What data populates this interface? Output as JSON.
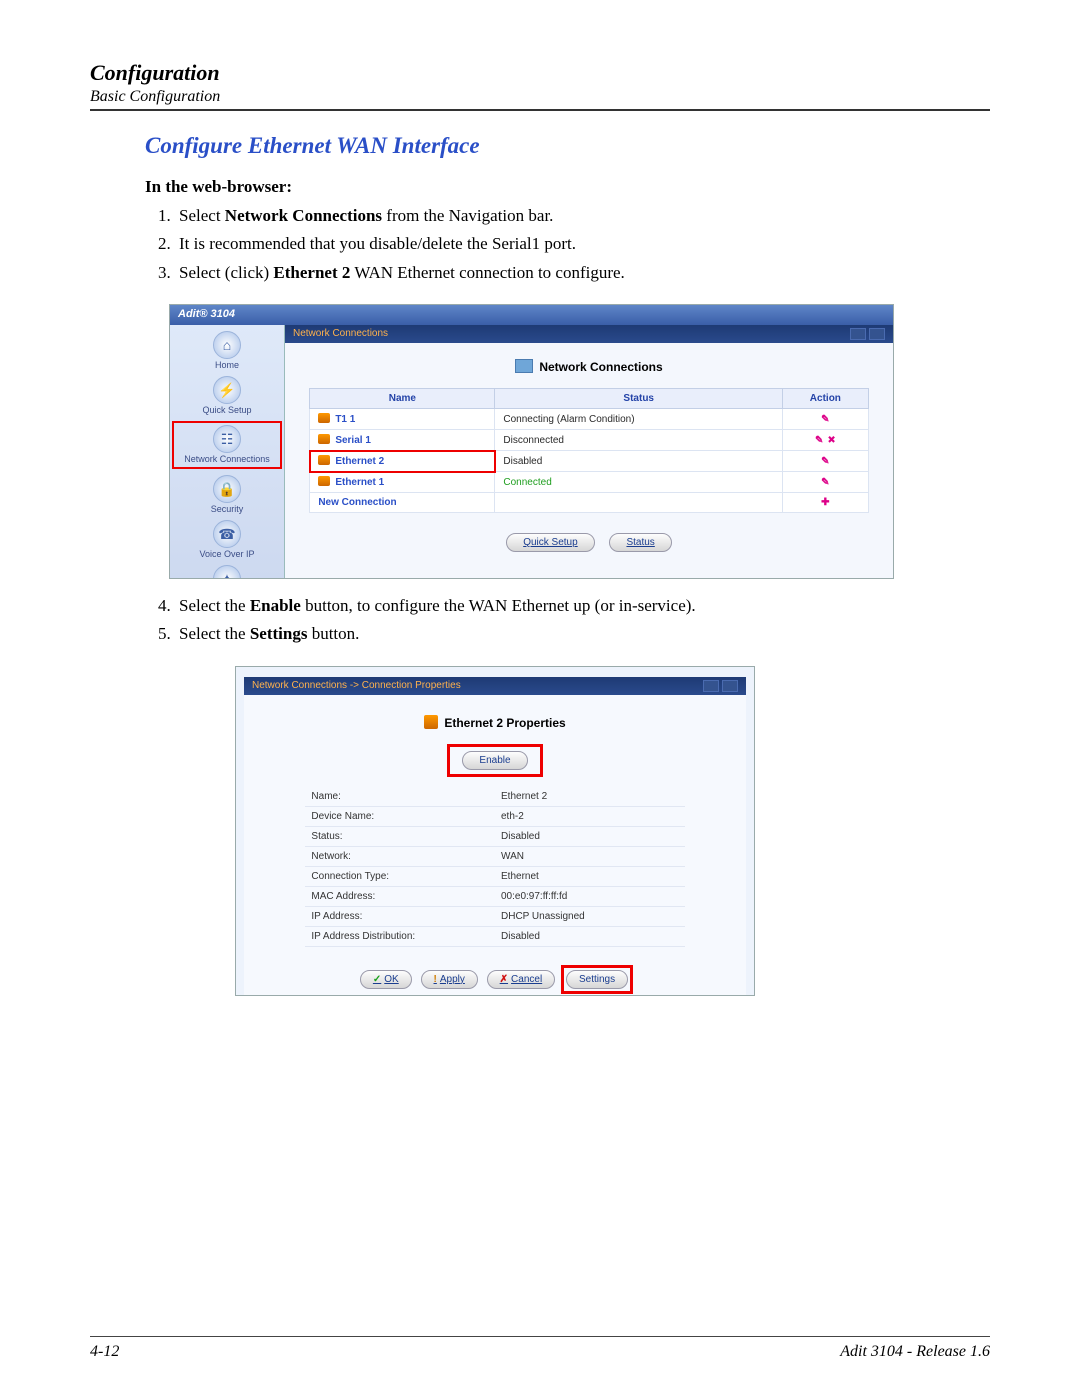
{
  "header": {
    "title": "Configuration",
    "sub": "Basic Configuration"
  },
  "section": {
    "title": "Configure Ethernet WAN Interface",
    "subhead": "In the web-browser:"
  },
  "steps": {
    "s1a": "Select ",
    "s1b": "Network Connections",
    "s1c": " from the Navigation bar.",
    "s2": "It is recommended that you disable/delete the Serial1 port.",
    "s3a": "Select (click) ",
    "s3b": "Ethernet 2",
    "s3c": " WAN Ethernet connection to configure.",
    "s4a": "Select the ",
    "s4b": "Enable",
    "s4c": " button, to configure the WAN Ethernet up (or in-service).",
    "s5a": "Select the ",
    "s5b": "Settings",
    "s5c": " button."
  },
  "shot1": {
    "app": "Adit® 3104",
    "crumb": "Network Connections",
    "paneTitle": "Network Connections",
    "nav": {
      "home": "Home",
      "quick": "Quick Setup",
      "net": "Network Connections",
      "sec": "Security",
      "voip": "Voice Over IP"
    },
    "cols": {
      "name": "Name",
      "status": "Status",
      "action": "Action"
    },
    "rows": [
      {
        "name": "T1 1",
        "status": "Connecting (Alarm Condition)",
        "cls": ""
      },
      {
        "name": "Serial 1",
        "status": "Disconnected",
        "cls": ""
      },
      {
        "name": "Ethernet 2",
        "status": "Disabled",
        "cls": "hl"
      },
      {
        "name": "Ethernet 1",
        "status": "Connected",
        "cls": "green"
      }
    ],
    "newconn": "New Connection",
    "btnQuick": "Quick Setup",
    "btnStatus": "Status"
  },
  "shot2": {
    "crumb": "Network Connections -> Connection Properties",
    "title": "Ethernet 2 Properties",
    "enable": "Enable",
    "rows": [
      {
        "k": "Name:",
        "v": "Ethernet 2"
      },
      {
        "k": "Device Name:",
        "v": "eth-2"
      },
      {
        "k": "Status:",
        "v": "Disabled"
      },
      {
        "k": "Network:",
        "v": "WAN"
      },
      {
        "k": "Connection Type:",
        "v": "Ethernet"
      },
      {
        "k": "MAC Address:",
        "v": "00:e0:97:ff:ff:fd"
      },
      {
        "k": "IP Address:",
        "v": "DHCP Unassigned"
      },
      {
        "k": "IP Address Distribution:",
        "v": "Disabled"
      }
    ],
    "ok": "OK",
    "apply": "Apply",
    "cancel": "Cancel",
    "settings": "Settings"
  },
  "footer": {
    "page": "4-12",
    "ver": "Adit 3104 - Release 1.6"
  }
}
